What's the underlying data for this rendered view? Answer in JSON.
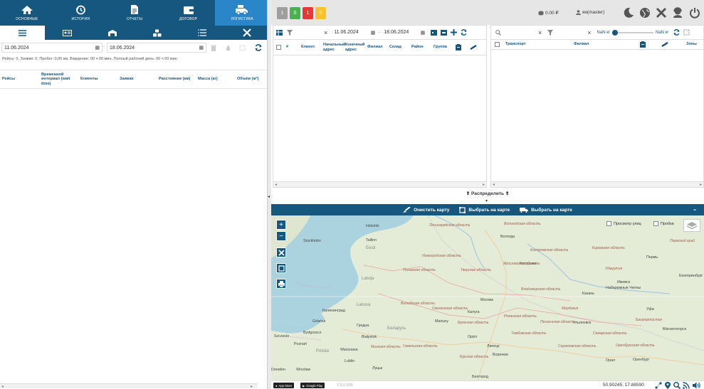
{
  "nav": {
    "items": [
      {
        "label": "ОСНОВНЫЕ",
        "icon": "home-icon"
      },
      {
        "label": "ИСТОРИЯ",
        "icon": "history-icon"
      },
      {
        "label": "ОТЧЕТЫ",
        "icon": "report-icon"
      },
      {
        "label": "ДОГОВОР",
        "icon": "wallet-icon"
      },
      {
        "label": "ЛОГИСТИКА",
        "icon": "truck-icon"
      }
    ],
    "active": "ЛОГИСТИКА"
  },
  "subtabs": [
    "menu-icon",
    "id-card-icon",
    "warehouse-icon",
    "boxes-icon",
    "list-icon",
    "tools-icon"
  ],
  "left": {
    "date_from": "11.06.2024",
    "date_to": "18.06.2024",
    "summary": "Рейсы: 0, Заявки: 0, Пробег: 0,00 км, Вождение: 00 ч 00 мин, Полный рабочий день: 00 ч 00 мин",
    "columns": [
      "Рейсы",
      "Временной интервал (wait time)",
      "Клиенты",
      "Заявки",
      "Расстояние (км)",
      "Масса (кг)",
      "Объём (м³)"
    ]
  },
  "top": {
    "badges": [
      {
        "value": "1",
        "color": "#9e9e9e"
      },
      {
        "value": "0",
        "color": "#4caf50"
      },
      {
        "value": "1",
        "color": "#e53935"
      },
      {
        "value": "0",
        "color": "#fbc02d"
      }
    ],
    "balance": "0.00 ₽",
    "user": "яя(master)"
  },
  "orders": {
    "date_from": "11.06.2024",
    "date_to": "18.06.2024",
    "columns": [
      "#",
      "Клиент",
      "Начальный адрес",
      "Конечный адрес",
      "Филиал",
      "Склад",
      "Район",
      "Группа"
    ]
  },
  "transport": {
    "weight_from": "NaN кг",
    "weight_to": "NaN кг",
    "columns": [
      "Транспорт",
      "Филиал",
      "Зоны"
    ]
  },
  "distribute_label": "⬆ Распределить ⬆",
  "mapbar": {
    "clear": "Очистить карту",
    "select1": "Выбрать на карте",
    "select2": "Выбрать на карте"
  },
  "map": {
    "streets_label": "Просмотр улиц",
    "traffic_label": "Пробки",
    "cities": [
      {
        "name": "Helsinki"
      },
      {
        "name": "Stockholm"
      },
      {
        "name": "Tallinn"
      },
      {
        "name": "Eesti"
      },
      {
        "name": "Latvija"
      },
      {
        "name": "Lietuva"
      },
      {
        "name": "Калининград"
      },
      {
        "name": "Gdańsk"
      },
      {
        "name": "Bydgoszcz"
      },
      {
        "name": "Szczecin"
      },
      {
        "name": "Poznań"
      },
      {
        "name": "Polska"
      },
      {
        "name": "Warszawa"
      },
      {
        "name": "Lublin"
      },
      {
        "name": "Wrocław"
      },
      {
        "name": "Гродна"
      },
      {
        "name": "Białystok"
      },
      {
        "name": "Беларусь"
      },
      {
        "name": "Mariuey"
      },
      {
        "name": "Калуга"
      },
      {
        "name": "Москва"
      },
      {
        "name": "Вологда"
      },
      {
        "name": "Кострома"
      },
      {
        "name": "Пермь"
      },
      {
        "name": "Ижевск"
      },
      {
        "name": "Набережные Челны"
      },
      {
        "name": "Казань"
      },
      {
        "name": "Екатеринбург"
      },
      {
        "name": "Уфа"
      },
      {
        "name": "Ульяновск"
      },
      {
        "name": "Магнитогорск"
      },
      {
        "name": "Оренбург"
      },
      {
        "name": "Орёл"
      },
      {
        "name": "Липецк"
      },
      {
        "name": "Воронеж"
      },
      {
        "name": "Белгород"
      },
      {
        "name": "Луцьк"
      },
      {
        "name": "Орал"
      },
      {
        "name": "Dresden"
      }
    ],
    "regions": [
      {
        "name": "Ленинградская область"
      },
      {
        "name": "Вологодская область"
      },
      {
        "name": "Костромская область"
      },
      {
        "name": "Кировская область"
      },
      {
        "name": "Новгородская область"
      },
      {
        "name": "Псковская область"
      },
      {
        "name": "Тверская область"
      },
      {
        "name": "Ярославская область"
      },
      {
        "name": "Владимирская область"
      },
      {
        "name": "Смоленская область"
      },
      {
        "name": "Витебская область"
      },
      {
        "name": "Брянская область"
      },
      {
        "name": "Рязанская область"
      },
      {
        "name": "Тамбовская область"
      },
      {
        "name": "Пензенская область"
      },
      {
        "name": "Саратовская область"
      },
      {
        "name": "Самарская область"
      },
      {
        "name": "Оренбургская область"
      },
      {
        "name": "Мордовия"
      },
      {
        "name": "Курская область"
      },
      {
        "name": "Пермский край"
      },
      {
        "name": "Удмуртия"
      },
      {
        "name": "Башкортостан"
      },
      {
        "name": "Гомельская область"
      },
      {
        "name": "Минская область"
      }
    ]
  },
  "bottom": {
    "appstore": "App Store",
    "googleplay": "Google Play",
    "version": "7.3.0.835",
    "coords": "50.90245, 17.88590"
  }
}
